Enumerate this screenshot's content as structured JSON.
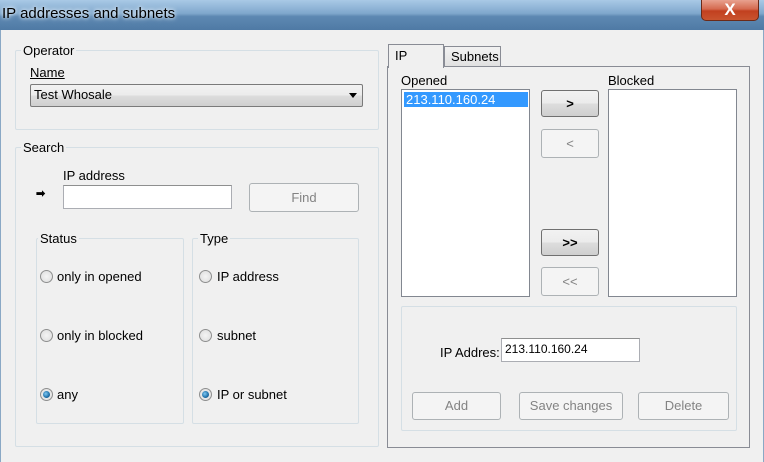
{
  "window": {
    "title": "IP addresses and subnets",
    "close_label": "X"
  },
  "operator": {
    "legend": "Operator",
    "name_label": "Name",
    "name_value": "Test Whosale"
  },
  "search": {
    "legend": "Search",
    "ip_label": "IP address",
    "ip_value": "",
    "find_label": "Find",
    "status": {
      "legend": "Status",
      "options": [
        "only in opened",
        "only in blocked",
        "any"
      ],
      "selected": "any"
    },
    "type": {
      "legend": "Type",
      "options": [
        "IP address",
        "subnet",
        "IP or subnet"
      ],
      "selected": "IP or subnet"
    }
  },
  "tabs": [
    {
      "label": "IP",
      "active": true
    },
    {
      "label": "Subnets",
      "active": false
    }
  ],
  "ip_tab": {
    "opened_label": "Opened",
    "opened_items": [
      "213.110.160.24"
    ],
    "blocked_label": "Blocked",
    "blocked_items": [],
    "move_buttons": [
      ">",
      "<",
      ">>",
      "<<"
    ],
    "ip_address_label": "IP Addres:",
    "ip_address_value": "213.110.160.24",
    "add_label": "Add",
    "save_label": "Save changes",
    "delete_label": "Delete"
  }
}
